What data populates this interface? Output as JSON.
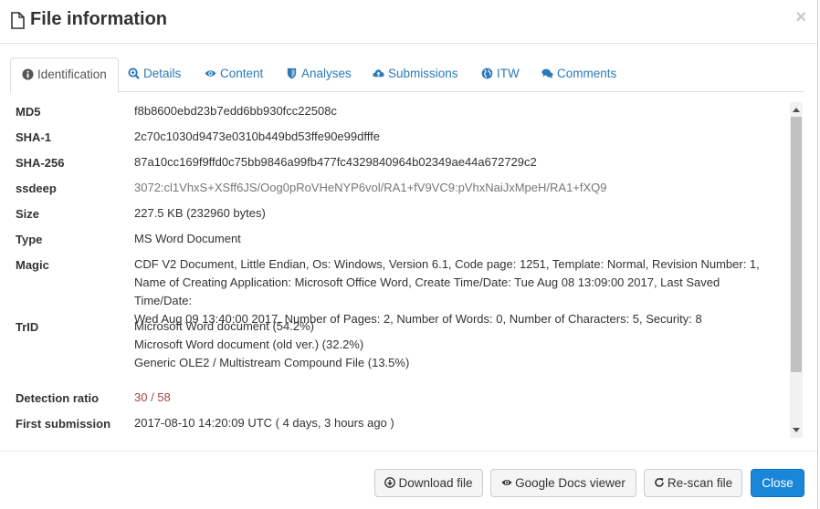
{
  "dialog": {
    "title": "File information",
    "close_glyph": "×"
  },
  "tabs": [
    {
      "label": "Identification",
      "icon": "info-circle-icon"
    },
    {
      "label": "Details",
      "icon": "search-plus-icon"
    },
    {
      "label": "Content",
      "icon": "eye-icon"
    },
    {
      "label": "Analyses",
      "icon": "shield-icon"
    },
    {
      "label": "Submissions",
      "icon": "cloud-upload-icon"
    },
    {
      "label": "ITW",
      "icon": "globe-icon"
    },
    {
      "label": "Comments",
      "icon": "comments-icon"
    }
  ],
  "info": {
    "md5": {
      "label": "MD5",
      "value": "f8b8600ebd23b7edd6bb930fcc22508c"
    },
    "sha1": {
      "label": "SHA-1",
      "value": "2c70c1030d9473e0310b449bd53ffe90e99dfffe"
    },
    "sha256": {
      "label": "SHA-256",
      "value": "87a10cc169f9ffd0c75bb9846a99fb477fc4329840964b02349ae44a672729c2"
    },
    "ssdeep": {
      "label": "ssdeep",
      "value": "3072:cl1VhxS+XSff6JS/Oog0pRoVHeNYP6vol/RA1+fV9VC9:pVhxNaiJxMpeH/RA1+fXQ9"
    },
    "size": {
      "label": "Size",
      "value": "227.5 KB (232960 bytes)"
    },
    "type": {
      "label": "Type",
      "value": "MS Word Document"
    },
    "magic": {
      "label": "Magic",
      "lines": [
        "CDF V2 Document, Little Endian, Os: Windows, Version 6.1, Code page: 1251, Template: Normal, Revision Number: 1,",
        "Name of Creating Application: Microsoft Office Word, Create Time/Date: Tue Aug 08 13:09:00 2017, Last Saved Time/Date:",
        "Wed Aug 09 13:40:00 2017, Number of Pages: 2, Number of Words: 0, Number of Characters: 5, Security: 8"
      ]
    },
    "trid": {
      "label": "TrID",
      "lines": [
        "Microsoft Word document (54.2%)",
        "Microsoft Word document (old ver.) (32.2%)",
        "Generic OLE2 / Multistream Compound File (13.5%)"
      ]
    },
    "detection": {
      "label": "Detection ratio",
      "value": "30 / 58",
      "color": "#a94442"
    },
    "first_submission": {
      "label": "First submission",
      "value": "2017-08-10 14:20:09 UTC ( 4 days, 3 hours ago )"
    }
  },
  "footer": {
    "download": {
      "label": "Download file",
      "icon": "arrow-circle-down-icon"
    },
    "gdocs": {
      "label": "Google Docs viewer",
      "icon": "eye-icon"
    },
    "rescan": {
      "label": "Re-scan file",
      "icon": "refresh-icon"
    },
    "close": {
      "label": "Close"
    }
  },
  "colors": {
    "link": "#2a7ab9",
    "primary": "#1a86d8"
  }
}
